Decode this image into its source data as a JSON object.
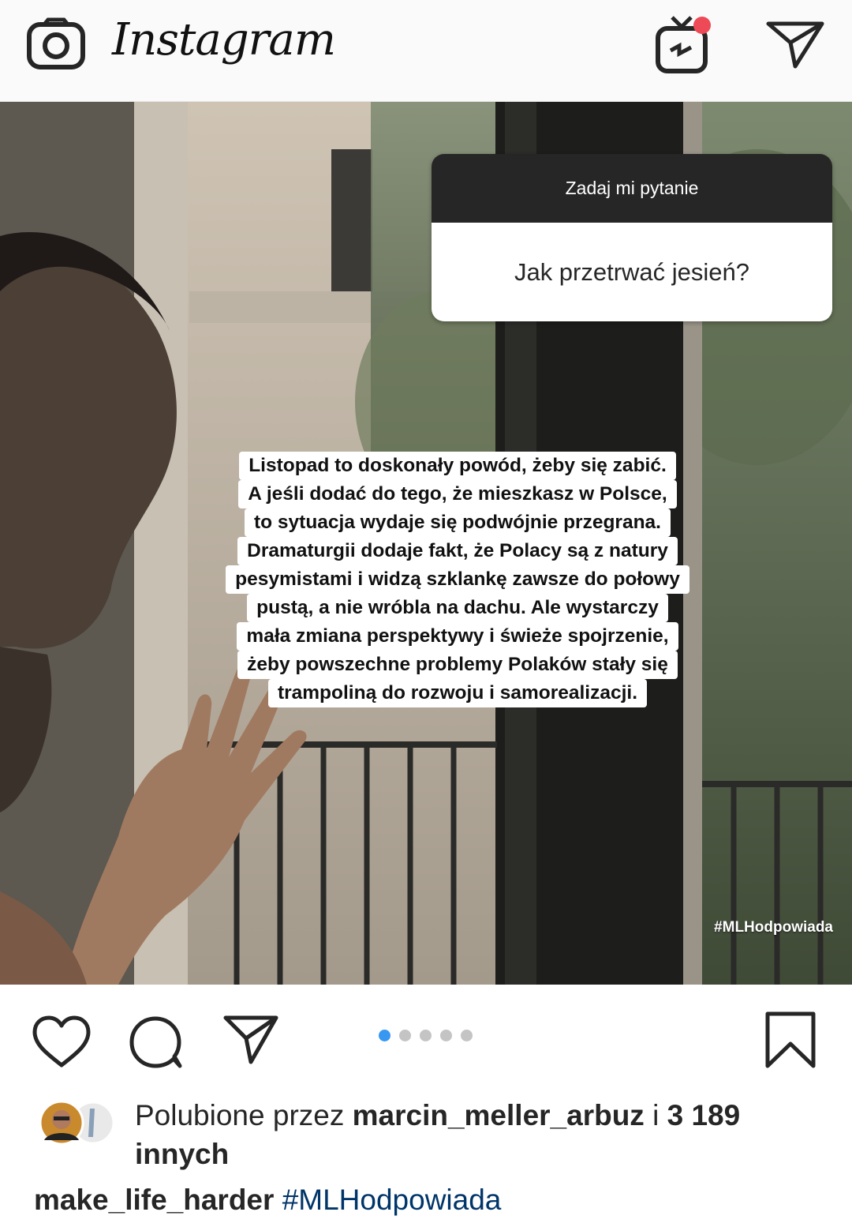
{
  "header": {
    "app_name": "Instagram"
  },
  "post": {
    "question_box": {
      "prompt": "Zadaj mi pytanie",
      "question": "Jak przetrwać jesień?"
    },
    "answer_lines": [
      "Listopad to doskonały powód, żeby się zabić.",
      "A jeśli dodać do tego, że mieszkasz w Polsce,",
      "to sytuacja wydaje się podwójnie przegrana.",
      "Dramaturgii dodaje fakt, że Polacy są z natury",
      "pesymistami i widzą szklankę zawsze do połowy",
      "pustą, a nie wróbla na dachu. Ale wystarczy",
      "mała zmiana perspektywy i świeże spojrzenie,",
      "żeby powszechne problemy Polaków stały się",
      "trampoliną do rozwoju i samorealizacji."
    ],
    "overlay_hashtag": "#MLHodpowiada"
  },
  "carousel": {
    "count": 5,
    "active_index": 0,
    "active_color": "#3897f0"
  },
  "likes": {
    "prefix": "Polubione przez",
    "user": "marcin_meller_arbuz",
    "connector": "i",
    "count": "3 189",
    "suffix": "innych"
  },
  "caption": {
    "username": "make_life_harder",
    "hashtag": "#MLHodpowiada"
  },
  "icons": [
    "camera-icon",
    "igtv-icon",
    "direct-message-icon",
    "heart-icon",
    "comment-icon",
    "share-icon",
    "bookmark-icon"
  ],
  "colors": {
    "notification_dot": "#ed4956",
    "hashtag_link": "#003569"
  }
}
